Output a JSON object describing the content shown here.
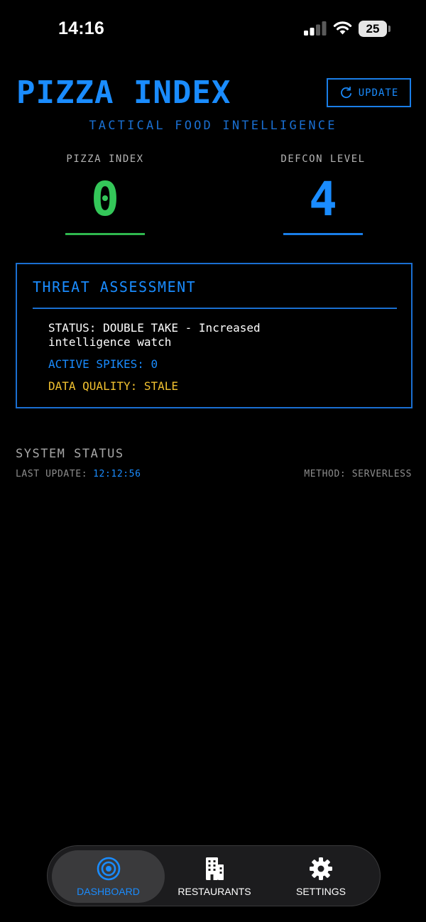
{
  "status_bar": {
    "time": "14:16",
    "battery": "25"
  },
  "header": {
    "title": "PIZZA INDEX",
    "update_label": "UPDATE",
    "subtitle": "TACTICAL FOOD INTELLIGENCE"
  },
  "metrics": {
    "pizza_index": {
      "label": "PIZZA INDEX",
      "value": "0"
    },
    "defcon": {
      "label": "DEFCON LEVEL",
      "value": "4"
    }
  },
  "threat": {
    "title": "THREAT ASSESSMENT",
    "status": "STATUS: DOUBLE TAKE - Increased intelligence watch",
    "active_spikes": "ACTIVE SPIKES: 0",
    "data_quality": "DATA QUALITY: STALE"
  },
  "system": {
    "title": "SYSTEM STATUS",
    "last_update_label": "LAST UPDATE:",
    "last_update_value": "12:12:56",
    "method": "METHOD: SERVERLESS"
  },
  "tabs": [
    {
      "label": "DASHBOARD",
      "icon": "target-icon"
    },
    {
      "label": "RESTAURANTS",
      "icon": "building-icon"
    },
    {
      "label": "SETTINGS",
      "icon": "gear-icon"
    }
  ],
  "colors": {
    "accent_blue": "#1a8cff",
    "green": "#34c759",
    "yellow": "#f2c230"
  }
}
